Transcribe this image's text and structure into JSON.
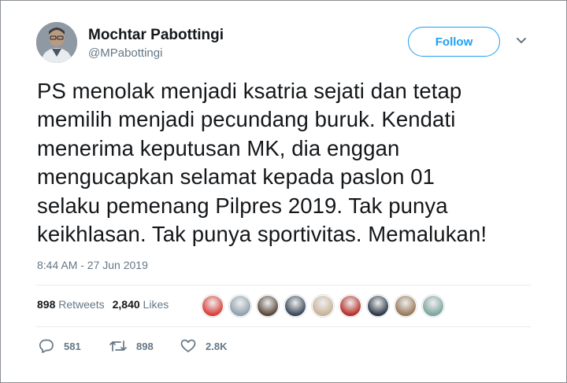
{
  "user": {
    "name": "Mochtar Pabottingi",
    "handle": "@MPabottingi"
  },
  "follow_label": "Follow",
  "tweet": {
    "lines": [
      "PS menolak menjadi ksatria sejati dan tetap",
      "memilih menjadi pecundang buruk. Kendati",
      "menerima keputusan MK, dia enggan",
      "mengucapkan selamat kepada paslon 01",
      "selaku pemenang Pilpres 2019. Tak punya",
      "keikhlasan. Tak punya sportivitas. Memalukan!"
    ],
    "timestamp": "8:44 AM - 27 Jun 2019"
  },
  "stats": {
    "retweets_count": "898",
    "retweets_label": "Retweets",
    "likes_count": "2,840",
    "likes_label": "Likes"
  },
  "likers": [
    {
      "color": "#d8423a"
    },
    {
      "color": "#8fa2ae"
    },
    {
      "color": "#5a4a3c"
    },
    {
      "color": "#3d4a5c"
    },
    {
      "color": "#c9b49a"
    },
    {
      "color": "#b8322a"
    },
    {
      "color": "#2f3a48"
    },
    {
      "color": "#9a7a5a"
    },
    {
      "color": "#7fa6a0"
    }
  ],
  "actions": {
    "replies": "581",
    "retweets": "898",
    "likes": "2.8K"
  },
  "colors": {
    "accent": "#1da1f2",
    "secondary_text": "#657786",
    "primary_text": "#14171a"
  },
  "icons": {
    "caret": "chevron-down-icon",
    "reply": "reply-icon",
    "retweet": "retweet-icon",
    "like": "heart-icon"
  }
}
